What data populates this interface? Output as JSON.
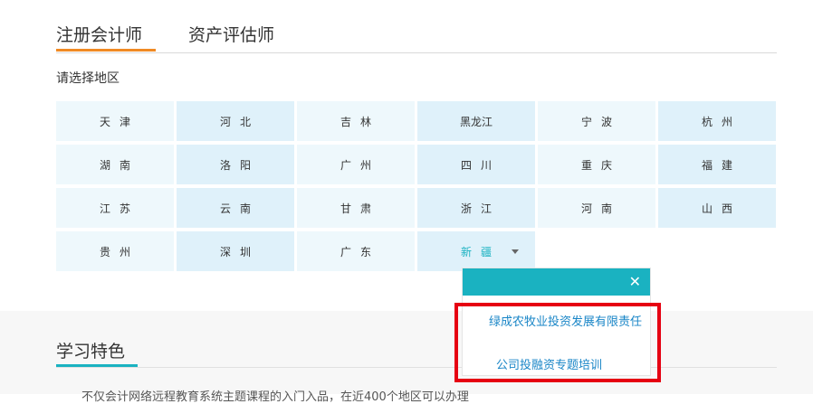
{
  "tabs": [
    "注册会计师",
    "资产评估师"
  ],
  "region_label": "请选择地区",
  "regions": [
    [
      "天津",
      "河北",
      "吉林",
      "黑龙江",
      "宁波",
      "杭州"
    ],
    [
      "湖南",
      "洛阳",
      "广州",
      "四川",
      "重庆",
      "福建"
    ],
    [
      "江苏",
      "云南",
      "甘肃",
      "浙江",
      "河南",
      "山西"
    ],
    [
      "贵州",
      "深圳",
      "广东",
      "新疆"
    ]
  ],
  "selected_region": "新疆",
  "popup": {
    "close_icon": "close-icon",
    "items": [
      "绿成农牧业投资发展有限责任",
      "公司投融资专题培训"
    ]
  },
  "section": {
    "title": "学习特色",
    "text": "不仅会计网络远程教育系统主题课程的入门入品，在近400个地区可以办理"
  },
  "colors": {
    "accent": "#1ab2c1",
    "tab_underline": "#f08a24",
    "highlight": "#e60012"
  }
}
